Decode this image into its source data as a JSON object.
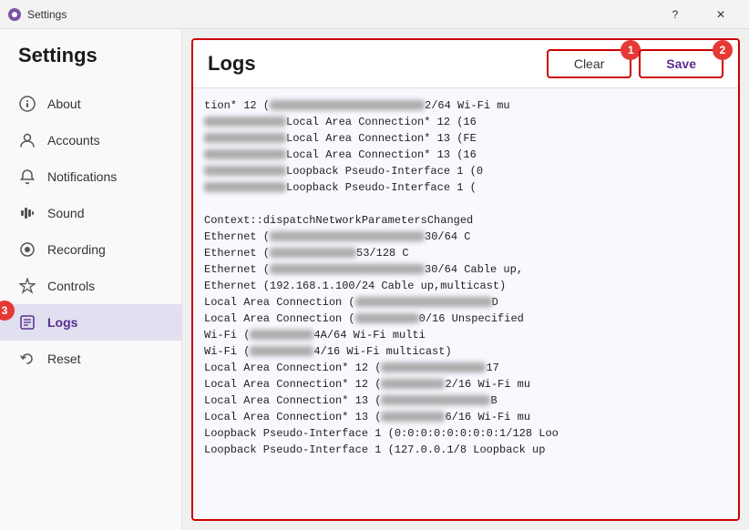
{
  "titlebar": {
    "title": "Settings",
    "help_btn": "?",
    "close_btn": "✕"
  },
  "sidebar": {
    "header": "Settings",
    "items": [
      {
        "id": "about",
        "label": "About",
        "icon": "ℹ"
      },
      {
        "id": "accounts",
        "label": "Accounts",
        "icon": "👤"
      },
      {
        "id": "notifications",
        "label": "Notifications",
        "icon": "🔔"
      },
      {
        "id": "sound",
        "label": "Sound",
        "icon": "🎛"
      },
      {
        "id": "recording",
        "label": "Recording",
        "icon": "⏺"
      },
      {
        "id": "controls",
        "label": "Controls",
        "icon": "✱"
      },
      {
        "id": "logs",
        "label": "Logs",
        "icon": "📋",
        "active": true
      },
      {
        "id": "reset",
        "label": "Reset",
        "icon": "↺"
      }
    ]
  },
  "logs": {
    "title": "Logs",
    "clear_label": "Clear",
    "save_label": "Save",
    "badge1": "1",
    "badge2": "2",
    "badge3": "3",
    "lines": [
      "tion* 12 (                                  2/64 Wi-Fi mu",
      "                  Local Area Connection* 12 (16",
      "                  Local Area Connection* 13 (FE",
      "                  Local Area Connection* 13 (16",
      "                  Loopback Pseudo-Interface 1 (0",
      "                  Loopback Pseudo-Interface 1 (",
      "",
      "Context::dispatchNetworkParametersChanged",
      "Ethernet (                                  30/64 C",
      "Ethernet (                   53/128 C",
      "Ethernet (                                  30/64 Cable up,",
      "Ethernet (192.168.1.100/24 Cable up,multicast)",
      "Local Area Connection (                              D",
      "Local Area Connection (              0/16 Unspecified",
      "Wi-Fi (              4A/64 Wi-Fi multi",
      "Wi-Fi (              4/16 Wi-Fi multicast)",
      "Local Area Connection* 12 (                       17",
      "Local Area Connection* 12 (              2/16 Wi-Fi mu",
      "Local Area Connection* 13 (                        B",
      "Local Area Connection* 13 (              6/16 Wi-Fi mu",
      "Loopback Pseudo-Interface 1 (0:0:0:0:0:0:0:0:1/128 Loo",
      "Loopback Pseudo-Interface 1 (127.0.0.1/8 Loopback up"
    ]
  }
}
